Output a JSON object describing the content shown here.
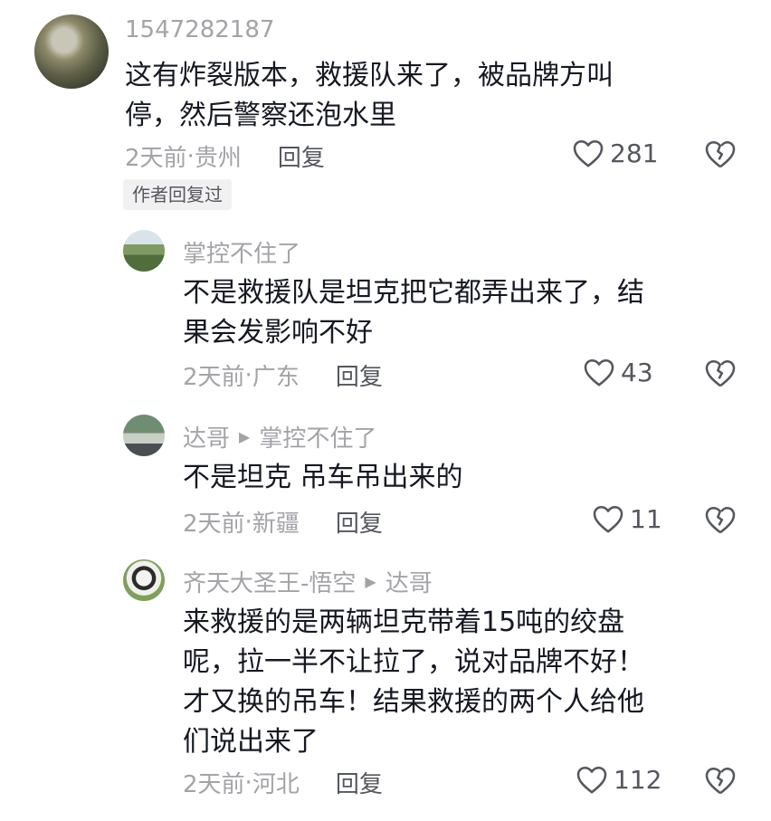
{
  "comments": [
    {
      "username": "1547282187",
      "content": [
        "这有炸裂版本，救援队来了，被品牌方叫",
        "停，然后警察还泡水里"
      ],
      "time": "2天前",
      "location": "贵州",
      "reply_label": "回复",
      "likes": "281",
      "author_replied": "作者回复过"
    },
    {
      "username": "掌控不住了",
      "content": [
        "不是救援队是坦克把它都弄出来了，结",
        "果会发影响不好"
      ],
      "time": "2天前",
      "location": "广东",
      "reply_label": "回复",
      "likes": "43"
    },
    {
      "username": "达哥",
      "reply_to": "掌控不住了",
      "content": [
        "不是坦克  吊车吊出来的"
      ],
      "time": "2天前",
      "location": "新疆",
      "reply_label": "回复",
      "likes": "11"
    },
    {
      "username": "齐天大圣王-悟空",
      "reply_to": "达哥",
      "content": [
        "来救援的是两辆坦克带着15吨的绞盘",
        "呢，拉一半不让拉了，说对品牌不好！",
        "才又换的吊车！结果救援的两个人给他",
        "们说出来了"
      ],
      "time": "2天前",
      "location": "河北",
      "reply_label": "回复",
      "likes": "112"
    }
  ],
  "meta_separator": " · "
}
